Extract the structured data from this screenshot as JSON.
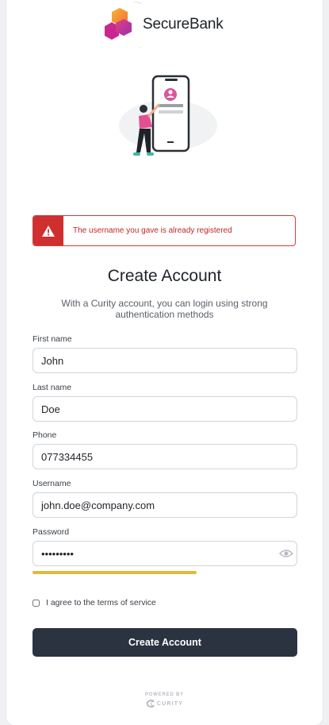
{
  "brand": {
    "name": "SecureBank"
  },
  "alert": {
    "message": "The username you gave is already registered",
    "icon": "warning-icon"
  },
  "heading": {
    "title": "Create Account",
    "subtitle": "With a Curity account, you can login using strong authentication methods"
  },
  "form": {
    "first_name": {
      "label": "First name",
      "value": "John"
    },
    "last_name": {
      "label": "Last name",
      "value": "Doe"
    },
    "phone": {
      "label": "Phone",
      "value": "077334455"
    },
    "username": {
      "label": "Username",
      "value": "john.doe@company.com"
    },
    "password": {
      "label": "Password",
      "value": "secretpwd",
      "strength_percent": 62
    },
    "terms": {
      "label": "I agree to the terms of service",
      "checked": false
    },
    "submit_label": "Create Account"
  },
  "footer": {
    "powered_by": "POWERED BY",
    "vendor": "CURITY"
  },
  "colors": {
    "error": "#d02f2f",
    "button": "#2b3340",
    "strength": "#e2b93b",
    "brand_pink": "#d8348f",
    "brand_orange": "#f39a2c"
  }
}
